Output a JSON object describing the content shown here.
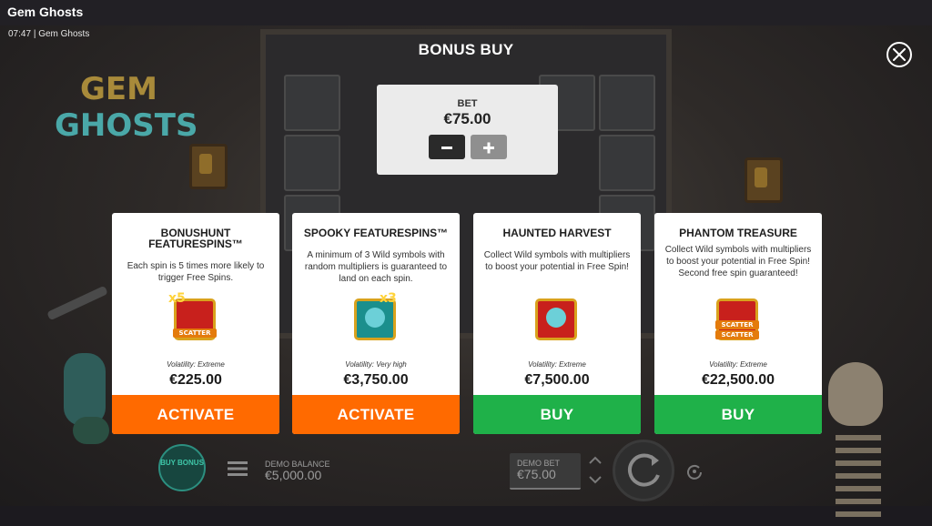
{
  "window": {
    "title": "Gem Ghosts",
    "time": "07:47",
    "game_name": "Gem Ghosts"
  },
  "background": {
    "logo_line1": "GEM",
    "logo_line2": "GHOSTS"
  },
  "bonus_buy": {
    "title": "BONUS BUY",
    "close_icon": "close-icon",
    "bet_label": "BET",
    "bet_value": "€75.00",
    "minus_icon": "minus-icon",
    "plus_icon": "plus-icon"
  },
  "cards": [
    {
      "title": "BONUSHUNT FEATURESPINS™",
      "description": "Each spin is 5 times more likely to trigger Free Spins.",
      "volatility": "Volatility: Extreme",
      "price": "€225.00",
      "button": "ACTIVATE",
      "button_color": "#ff6a00",
      "icon_multiplier": "x5",
      "icon_text": "SCATTER"
    },
    {
      "title": "SPOOKY FEATURESPINS™",
      "description": "A minimum of 3 Wild symbols with random multipliers is guaranteed to land on each spin.",
      "volatility": "Volatility: Very high",
      "price": "€3,750.00",
      "button": "ACTIVATE",
      "button_color": "#ff6a00",
      "icon_multiplier": "x3"
    },
    {
      "title": "HAUNTED HARVEST",
      "description": "Collect Wild symbols with multipliers to boost your potential in Free Spin!",
      "volatility": "Volatility: Extreme",
      "price": "€7,500.00",
      "button": "BUY",
      "button_color": "#1fb149"
    },
    {
      "title": "PHANTOM TREASURE",
      "description": "Collect Wild symbols with multipliers to boost your potential in Free Spin! Second free spin guaranteed!",
      "volatility": "Volatility: Extreme",
      "price": "€22,500.00",
      "button": "BUY",
      "button_color": "#1fb149",
      "icon_text_1": "SCATTER",
      "icon_text_2": "SCATTER"
    }
  ],
  "bottom_bar": {
    "buy_bonus_label": "BUY BONUS",
    "balance_label": "DEMO BALANCE",
    "balance_value": "€5,000.00",
    "demo_bet_label": "DEMO BET",
    "demo_bet_value": "€75.00"
  }
}
